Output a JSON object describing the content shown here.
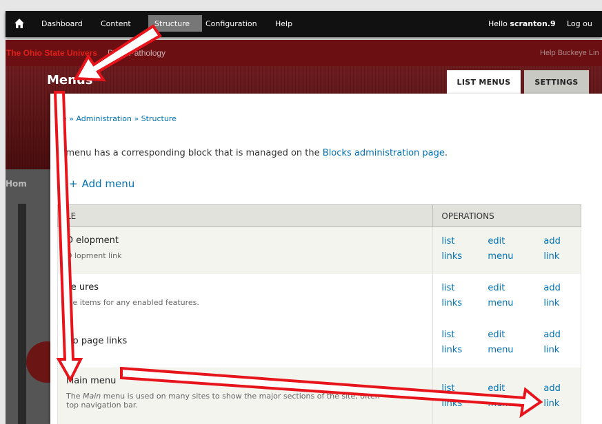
{
  "toolbar": {
    "home_icon": "home-icon",
    "items": [
      "Dashboard",
      "Content",
      "Structure",
      "Configuration",
      "Help"
    ],
    "hello_prefix": "Hello ",
    "username": "scranton.9",
    "logout": "Log ou"
  },
  "site": {
    "org": "The Ohio State Univers",
    "dept": "Plant Pathology",
    "right_links": "Help  Buckeye Lin"
  },
  "page": {
    "title": "Menus",
    "tabs": [
      "LIST MENUS",
      "SETTINGS"
    ],
    "left_label": "Hom"
  },
  "breadcrumb": "ne » Administration » Structure",
  "intro": {
    "before": "h menu has a corresponding block that is managed on the ",
    "link": "Blocks administration page",
    "after": "."
  },
  "add_menu": "Add menu",
  "table": {
    "headers": [
      "LE",
      "OPERATIONS"
    ],
    "rows": [
      {
        "name": "D   elopment",
        "description": "D   lopment link",
        "ops": [
          "list",
          "links",
          "edit",
          "menu",
          "add",
          "link"
        ]
      },
      {
        "name": "Fe   ures",
        "description": "Me   items for any enabled features.",
        "ops": [
          "list",
          "links",
          "edit",
          "menu",
          "add",
          "link"
        ]
      },
      {
        "name": "Ho   page links",
        "description": "",
        "ops": [
          "list",
          "links",
          "edit",
          "menu",
          "add",
          "link"
        ]
      },
      {
        "name": "Main menu",
        "description_em": "Main",
        "description_before": "The ",
        "description_after": " menu is used on many sites to show the major sections of the site, often",
        "description_line2": "top navigation bar.",
        "ops": [
          "list",
          "links",
          "edit",
          "menu",
          "add",
          "link"
        ]
      }
    ]
  },
  "colors": {
    "link": "#0071b3",
    "arrow": "#e8141b",
    "toolbar": "#111111",
    "banner": "#6b0f12"
  }
}
